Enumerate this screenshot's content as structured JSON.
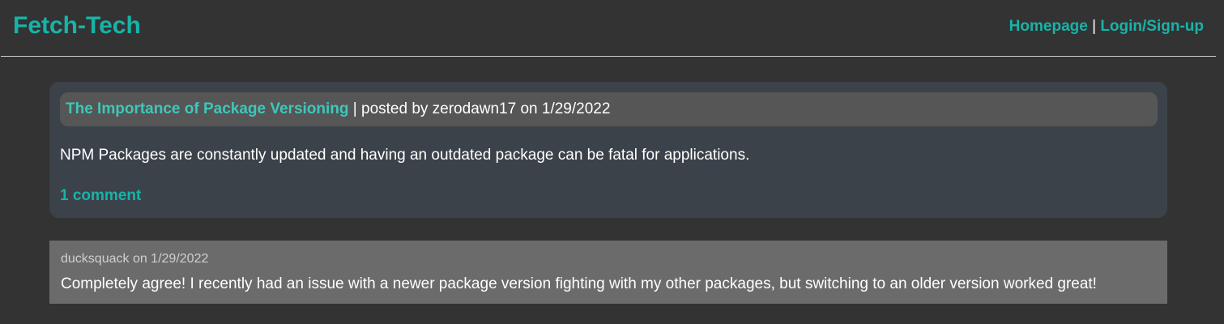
{
  "header": {
    "title": "Fetch-Tech",
    "nav": {
      "homepage": "Homepage",
      "separator": "|",
      "login": "Login/Sign-up"
    }
  },
  "post": {
    "title": "The Importance of Package Versioning",
    "meta": "| posted by zerodawn17 on 1/29/2022",
    "body": "NPM Packages are constantly updated and having an outdated package can be fatal for applications.",
    "comments_link": "1 comment"
  },
  "comments": [
    {
      "meta": "ducksquack on 1/29/2022",
      "text": "Completely agree! I recently had an issue with a newer package version fighting with my other packages, but switching to an older version worked great!"
    }
  ],
  "colors": {
    "accent": "#17b3a8",
    "background": "#333333",
    "card": "#3b424a",
    "comment": "#6b6b6b"
  }
}
